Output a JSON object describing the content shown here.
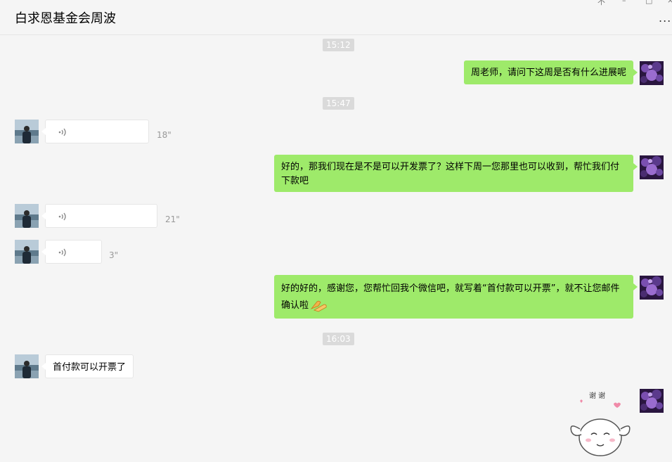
{
  "header": {
    "title": "白求恩基金会周波",
    "more_glyph": "..."
  },
  "window_controls": {
    "pin": "不",
    "minimize": "–",
    "maximize": "□",
    "close": "×"
  },
  "timestamps": [
    "15:12",
    "15:47",
    "16:03"
  ],
  "messages": [
    {
      "from": "me",
      "text": "周老师，请问下这周是否有什么进展呢"
    },
    {
      "from": "them",
      "type": "voice",
      "duration": "18\""
    },
    {
      "from": "me",
      "text": "好的，那我们现在是不是可以开发票了？这样下周一您那里也可以收到，帮忙我们付下款吧"
    },
    {
      "from": "them",
      "type": "voice",
      "duration": "21\""
    },
    {
      "from": "them",
      "type": "voice",
      "duration": "3\""
    },
    {
      "from": "me",
      "text": "好的好的，感谢您，您帮忙回我个微信吧，就写着“首付款可以开票”，就不让您邮件确认啦",
      "emoji": "handshake-emoji"
    },
    {
      "from": "them",
      "text": "首付款可以开票了"
    },
    {
      "from": "me",
      "type": "sticker",
      "sticker_text": "谢 谢"
    }
  ],
  "colors": {
    "my_bubble": "#9eea6a",
    "their_bubble": "#ffffff",
    "background": "#f5f5f5",
    "timestamp_bg": "#dadada"
  }
}
